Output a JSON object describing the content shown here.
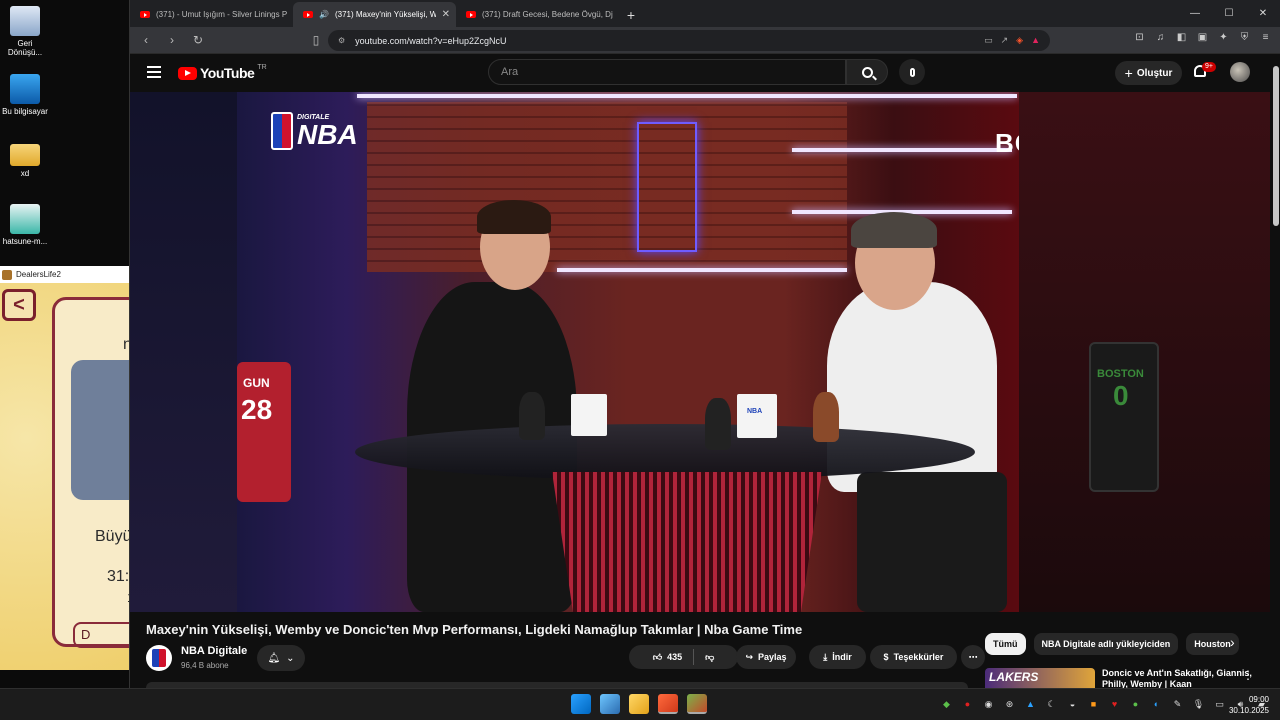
{
  "desktop": {
    "icons": [
      {
        "label": "Geri Dönüşü...",
        "icon": "recycle-bin-icon"
      },
      {
        "label": "Bu bilgisayar",
        "icon": "computer-icon"
      },
      {
        "label": "xd",
        "icon": "folder-icon"
      },
      {
        "label": "hatsune-m...",
        "icon": "image-file-icon"
      }
    ]
  },
  "game_window": {
    "title": "DealersLife2",
    "back_glyph": "<",
    "text_top": "n",
    "text_mid": "Büyü",
    "text_num": "31:",
    "text_small": "1",
    "button_label": "D"
  },
  "browser": {
    "tabs": [
      {
        "title": "(371) - Umut Işığım - Silver Linings Pl",
        "active": false
      },
      {
        "title": "(371) Maxey'nin Yükselişi, We",
        "active": true,
        "audio": "🔊"
      },
      {
        "title": "(371) Draft Gecesi, Bedene Övgü, Dj",
        "active": false
      }
    ],
    "new_tab": "+",
    "url": "youtube.com/watch?v=eHup2ZcgNcU"
  },
  "youtube": {
    "logo_word": "YouTube",
    "region": "TR",
    "search_placeholder": "Ara",
    "create_label": "Oluştur",
    "notifications_badge": "9+",
    "video_overlay": {
      "brand_small": "DIGITALE",
      "brand_big": "NBA",
      "sponsor": "BOYNER",
      "jersey_left_name": "GUN",
      "jersey_left_number": "28",
      "jersey_right_name": "BOSTON",
      "jersey_right_number": "0",
      "mug_label": "NBA"
    },
    "video_title": "Maxey'nin Yükselişi, Wemby ve Doncic'ten Mvp Performansı, Ligdeki Namağlup Takımlar | Nba Game Time",
    "channel_name": "NBA Digitale",
    "channel_subs": "96,4 B abone",
    "like_count": "435",
    "share_label": "Paylaş",
    "download_label": "İndir",
    "thanks_label": "Teşekkürler",
    "chips": [
      "Tümü",
      "NBA Digitale adlı yükleyiciden",
      "Houston"
    ],
    "rec_thumb_text": "LAKERS",
    "rec_title": "Doncic ve Ant'ın Sakatlığı, Giannis, Philly, Wemby | Kaan"
  },
  "taskbar": {
    "time": "09:00",
    "date": "30.10.2025"
  },
  "colors": {
    "yt_red": "#ff0000",
    "dark_bg": "#0f0f0f",
    "chip_active": "#f1f1f1"
  }
}
